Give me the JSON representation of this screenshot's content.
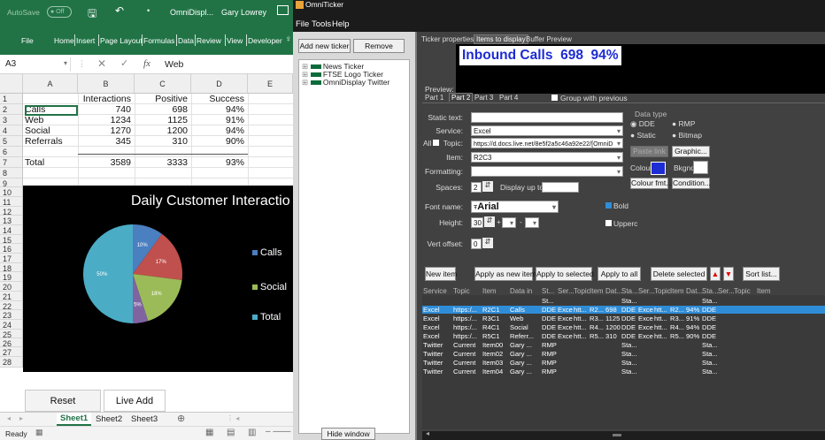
{
  "excel": {
    "autosave": "AutoSave",
    "autosave_state": "Off",
    "doc_title": "OmniDispl...",
    "user": "Gary Lowrey",
    "tabs": [
      "File",
      "Home",
      "Insert",
      "Page Layout",
      "Formulas",
      "Data",
      "Review",
      "View",
      "Developer"
    ],
    "name_box": "A3",
    "formula_value": "Web",
    "fx": "fx",
    "columns": [
      "A",
      "B",
      "C",
      "D",
      "E"
    ],
    "rows": [
      "1",
      "2",
      "3",
      "4",
      "5",
      "6",
      "7",
      "8",
      "9",
      "10",
      "11",
      "12",
      "13",
      "14",
      "15",
      "16",
      "17",
      "18",
      "19",
      "20",
      "21",
      "22",
      "23",
      "24",
      "25",
      "26",
      "27",
      "28"
    ],
    "header": {
      "b": "Interactions",
      "c": "Positive",
      "d": "Success"
    },
    "table": [
      {
        "a": "Calls",
        "b": "740",
        "c": "698",
        "d": "94%"
      },
      {
        "a": "Web",
        "b": "1234",
        "c": "1125",
        "d": "91%"
      },
      {
        "a": "Social",
        "b": "1270",
        "c": "1200",
        "d": "94%"
      },
      {
        "a": "Referrals",
        "b": "345",
        "c": "310",
        "d": "90%"
      }
    ],
    "total": {
      "a": "Total",
      "b": "3589",
      "c": "3333",
      "d": "93%"
    },
    "buttons": {
      "reset": "Reset",
      "live_add": "Live Add"
    },
    "sheets": [
      "Sheet1",
      "Sheet2",
      "Sheet3"
    ],
    "status": "Ready"
  },
  "chart_data": {
    "type": "pie",
    "title": "Daily Customer Interactio",
    "slices": [
      {
        "label": "10%",
        "value": 10,
        "color": "#4a7fc0"
      },
      {
        "label": "17%",
        "value": 17,
        "color": "#c0504d"
      },
      {
        "label": "18%",
        "value": 18,
        "color": "#9bbb59"
      },
      {
        "label": "5%",
        "value": 5,
        "color": "#8064a2"
      },
      {
        "label": "50%",
        "value": 50,
        "color": "#4bacc6"
      }
    ],
    "legend": [
      {
        "name": "Calls",
        "color": "#4a7fc0"
      },
      {
        "name": "Social",
        "color": "#9bbb59"
      },
      {
        "name": "Total",
        "color": "#4bacc6"
      }
    ]
  },
  "omni": {
    "title": "OmniTicker",
    "menu": [
      "File",
      "Tools",
      "Help"
    ],
    "add_ticker": "Add new ticker",
    "remove": "Remove",
    "tree": [
      "News Ticker",
      "FTSE Logo Ticker",
      "OmniDisplay Twitter"
    ],
    "hide_window": "Hide window",
    "top_tabs": [
      "Ticker properties",
      "Items to display",
      "Buffer Preview"
    ],
    "preview_label": "Preview:",
    "preview_text": "Inbound Calls  698  94%",
    "part_tabs": [
      "Part 1",
      "Part 2",
      "Part 3",
      "Part 4"
    ],
    "group_prev": "Group with previous",
    "static_text": "Static text:",
    "service": "Service:",
    "service_val": "Excel",
    "all_label": "All",
    "topic": "Topic:",
    "topic_val": "https://d.docs.live.net/8e5f2a5c46a92e22/[OmniD",
    "item": "Item:",
    "item_val": "R2C3",
    "formatting": "Formatting:",
    "spaces": "Spaces:",
    "spaces_val": "2",
    "display_up": "Display up to:",
    "font_name": "Font name:",
    "font_val": "Arial",
    "bold": "Bold",
    "height": "Height:",
    "height_val": "30",
    "upper": "Upperc",
    "vert_offset": "Vert offset:",
    "vert_val": "0",
    "data_type": "Data type",
    "dde": "DDE",
    "rmp": "RMP",
    "static": "Static",
    "bitmap": "Bitmap",
    "paste_link": "Paste link",
    "graphic": "Graphic...",
    "colour": "Colour:",
    "bkgnd": "Bkgnd:",
    "colour_fmt": "Colour fmt...",
    "condition": "Condition...",
    "actions": [
      "New item",
      "Apply as new item",
      "Apply to selected",
      "Apply to all",
      "Delete selected",
      "Sort list..."
    ],
    "headers": [
      "Service",
      "Topic",
      "Item",
      "Data in",
      "St...",
      "Ser...",
      "Topic",
      "Item",
      "Dat...",
      "Sta...",
      "Ser...",
      "Topic",
      "Item",
      "Dat...",
      "Sta...",
      "Ser...",
      "Topic",
      "Item"
    ],
    "rows": [
      [
        "",
        "",
        "",
        "",
        "St...",
        "",
        "",
        "",
        "",
        "Sta...",
        "",
        "",
        "",
        "",
        "Sta..."
      ],
      [
        "Excel",
        "https:/...",
        "R2C1",
        "Calls",
        "DDE",
        "Excel",
        "htt...",
        "R2...",
        "698",
        "DDE",
        "Excel",
        "htt...",
        "R2...",
        "94%",
        "DDE"
      ],
      [
        "Excel",
        "https:/...",
        "R3C1",
        "Web",
        "DDE",
        "Excel",
        "htt...",
        "R3...",
        "1125",
        "DDE",
        "Excel",
        "htt...",
        "R3...",
        "91%",
        "DDE"
      ],
      [
        "Excel",
        "https:/...",
        "R4C1",
        "Social",
        "DDE",
        "Excel",
        "htt...",
        "R4...",
        "1200",
        "DDE",
        "Excel",
        "htt...",
        "R4...",
        "94%",
        "DDE"
      ],
      [
        "Excel",
        "https:/...",
        "R5C1",
        "Referr...",
        "DDE",
        "Excel",
        "htt...",
        "R5...",
        "310",
        "DDE",
        "Excel",
        "htt...",
        "R5...",
        "90%",
        "DDE"
      ],
      [
        "Twitter",
        "Current",
        "Item00",
        "Gary ...",
        "RMP",
        "",
        "",
        "",
        "",
        "Sta...",
        "",
        "",
        "",
        "",
        "Sta..."
      ],
      [
        "Twitter",
        "Current",
        "Item02",
        "Gary ...",
        "RMP",
        "",
        "",
        "",
        "",
        "Sta...",
        "",
        "",
        "",
        "",
        "Sta..."
      ],
      [
        "Twitter",
        "Current",
        "Item03",
        "Gary ...",
        "RMP",
        "",
        "",
        "",
        "",
        "Sta...",
        "",
        "",
        "",
        "",
        "Sta..."
      ],
      [
        "Twitter",
        "Current",
        "Item04",
        "Gary ...",
        "RMP",
        "",
        "",
        "",
        "",
        "Sta...",
        "",
        "",
        "",
        "",
        "Sta..."
      ]
    ]
  }
}
